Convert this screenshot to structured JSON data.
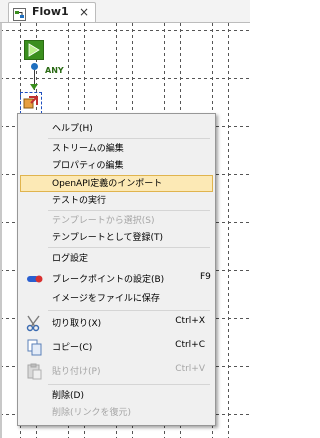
{
  "tab": {
    "label": "Flow1",
    "close": "×"
  },
  "canvas": {
    "connector_label": "ANY"
  },
  "menu": {
    "items": [
      {
        "label": "ヘルプ(H)"
      },
      {
        "label": "ストリームの編集"
      },
      {
        "label": "プロパティの編集"
      },
      {
        "label": "OpenAPI定義のインポート"
      },
      {
        "label": "テストの実行"
      },
      {
        "label": "テンプレートから選択(S)"
      },
      {
        "label": "テンプレートとして登録(T)"
      },
      {
        "label": "ログ設定"
      },
      {
        "label": "ブレークポイントの設定(B)",
        "shortcut": "F9"
      },
      {
        "label": "イメージをファイルに保存"
      },
      {
        "label": "切り取り(X)",
        "shortcut": "Ctrl+X"
      },
      {
        "label": "コピー(C)",
        "shortcut": "Ctrl+C"
      },
      {
        "label": "貼り付け(P)",
        "shortcut": "Ctrl+V"
      },
      {
        "label": "削除(D)"
      },
      {
        "label": "削除(リンクを復元)"
      }
    ]
  },
  "colors": {
    "highlight": "#fce9b5",
    "highlight_border": "#e0b44e",
    "start_node": "#3a8f1e",
    "disabled_text": "#a5a5a5"
  }
}
